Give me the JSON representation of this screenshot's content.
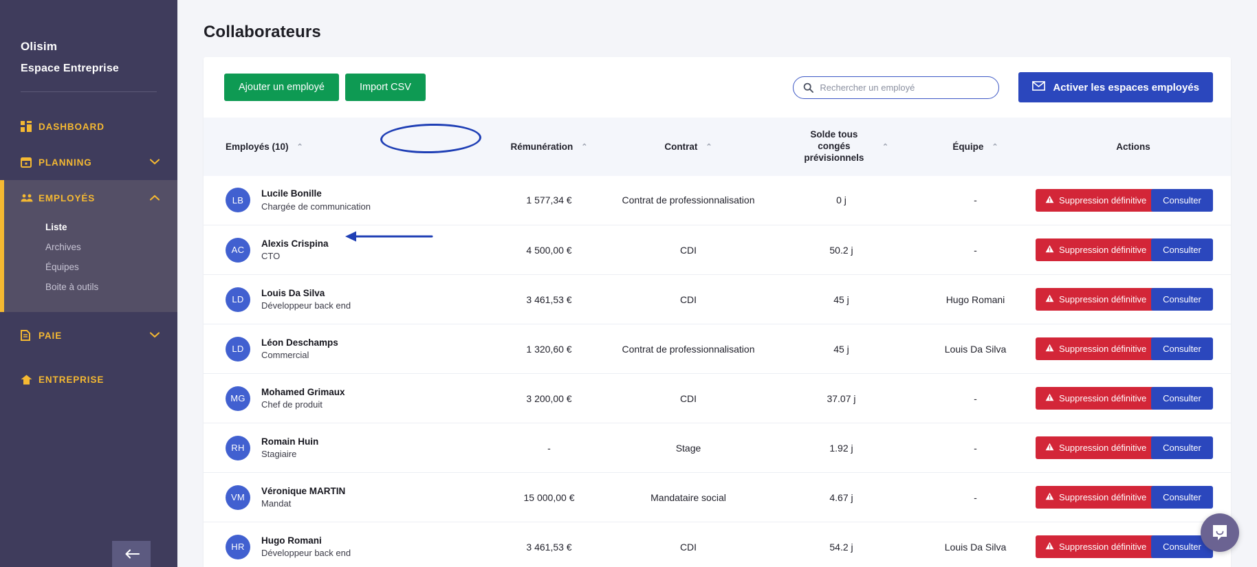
{
  "sidebar": {
    "brand_name": "Olisim",
    "brand_sub": "Espace Entreprise",
    "items": [
      {
        "label": "DASHBOARD",
        "icon": "grid-icon",
        "expandable": false
      },
      {
        "label": "PLANNING",
        "icon": "calendar-icon",
        "expandable": true,
        "chevron": "⌄"
      },
      {
        "label": "EMPLOYÉS",
        "icon": "people-icon",
        "expandable": true,
        "chevron": "⌃",
        "active": true
      },
      {
        "label": "PAIE",
        "icon": "document-icon",
        "expandable": true,
        "chevron": "⌄"
      },
      {
        "label": "ENTREPRISE",
        "icon": "home-icon",
        "expandable": false
      }
    ],
    "employes_sub": [
      {
        "label": "Liste",
        "active": true
      },
      {
        "label": "Archives",
        "active": false
      },
      {
        "label": "Équipes",
        "active": false
      },
      {
        "label": "Boite à outils",
        "active": false
      }
    ],
    "collapse_icon": "collapse-left-icon"
  },
  "page": {
    "title": "Collaborateurs"
  },
  "toolbar": {
    "add_employee_label": "Ajouter un employé",
    "import_csv_label": "Import CSV",
    "activate_label": "Activer les espaces employés",
    "activate_icon": "envelope-icon"
  },
  "search": {
    "placeholder": "Rechercher un employé",
    "value": "",
    "icon": "search-icon"
  },
  "table": {
    "columns": [
      {
        "label": "Employés (10)",
        "sortable": true
      },
      {
        "label": "Rémunération",
        "sortable": true
      },
      {
        "label": "Contrat",
        "sortable": true
      },
      {
        "label": "Solde tous congés prévisionnels",
        "sortable": true
      },
      {
        "label": "Équipe",
        "sortable": true
      },
      {
        "label": "Actions",
        "sortable": false
      }
    ],
    "sort_caret": "⌃",
    "delete_label": "Suppression définitive",
    "delete_icon": "warning-triangle-icon",
    "consult_label": "Consulter",
    "rows": [
      {
        "initials": "LB",
        "name": "Lucile Bonille",
        "role": "Chargée de communication",
        "remuneration": "1 577,34 €",
        "contract": "Contrat de professionnalisation",
        "balance": "0 j",
        "team": "-"
      },
      {
        "initials": "AC",
        "name": "Alexis Crispina",
        "role": "CTO",
        "remuneration": "4 500,00 €",
        "contract": "CDI",
        "balance": "50.2 j",
        "team": "-"
      },
      {
        "initials": "LD",
        "name": "Louis Da Silva",
        "role": "Développeur back end",
        "remuneration": "3 461,53 €",
        "contract": "CDI",
        "balance": "45 j",
        "team": "Hugo Romani"
      },
      {
        "initials": "LD",
        "name": "Léon Deschamps",
        "role": "Commercial",
        "remuneration": "1 320,60 €",
        "contract": "Contrat de professionnalisation",
        "balance": "45 j",
        "team": "Louis Da Silva"
      },
      {
        "initials": "MG",
        "name": "Mohamed Grimaux",
        "role": "Chef de produit",
        "remuneration": "3 200,00 €",
        "contract": "CDI",
        "balance": "37.07 j",
        "team": "-"
      },
      {
        "initials": "RH",
        "name": "Romain Huin",
        "role": "Stagiaire",
        "remuneration": "-",
        "contract": "Stage",
        "balance": "1.92 j",
        "team": "-"
      },
      {
        "initials": "VM",
        "name": "Véronique MARTIN",
        "role": "Mandat",
        "remuneration": "15 000,00 €",
        "contract": "Mandataire social",
        "balance": "4.67 j",
        "team": "-"
      },
      {
        "initials": "HR",
        "name": "Hugo Romani",
        "role": "Développeur back end",
        "remuneration": "3 461,53 €",
        "contract": "CDI",
        "balance": "54.2 j",
        "team": "Louis Da Silva"
      }
    ]
  },
  "annotations": {
    "ellipse_target": "Employés (10)",
    "arrow_target": "employee-row-alexis-crispina",
    "color": "#1f3fb5"
  },
  "chat": {
    "icon": "chat-bubble-icon"
  },
  "colors": {
    "sidebar_bg": "#3f3c5c",
    "sidebar_accent": "#f5b932",
    "green": "#0e9a53",
    "blue": "#2b47bd",
    "red": "#d32638",
    "avatar": "#4160d0",
    "annotation": "#1f3fb5"
  }
}
